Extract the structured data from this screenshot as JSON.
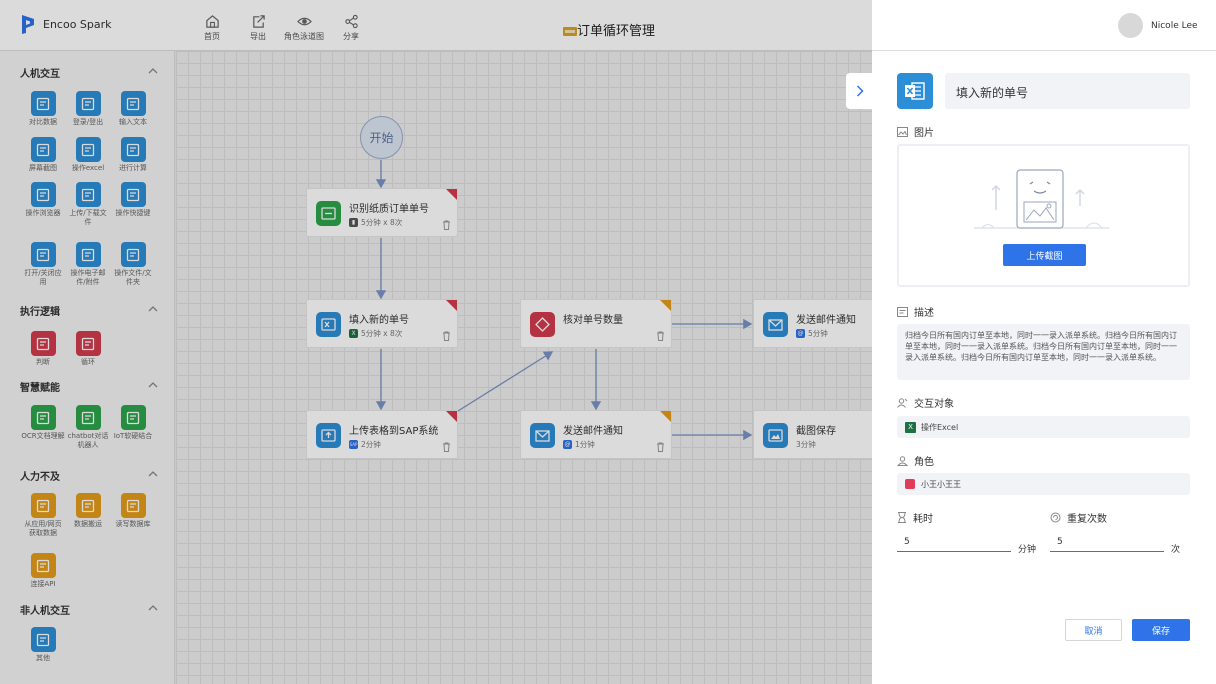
{
  "app": {
    "name": "Encoo Spark"
  },
  "toolbar": {
    "home": "首页",
    "export": "导出",
    "swimlane": "角色泳道图",
    "share": "分享"
  },
  "page": {
    "title": "订单循环管理"
  },
  "user": {
    "name": "Nicole Lee"
  },
  "sidebar": {
    "sections": [
      {
        "title": "人机交互",
        "items": [
          {
            "label": "对比数据",
            "icon": "compare-data-icon"
          },
          {
            "label": "登录/登出",
            "icon": "login-icon"
          },
          {
            "label": "输入文本",
            "icon": "input-text-icon"
          },
          {
            "label": "屏幕截图",
            "icon": "screenshot-icon"
          },
          {
            "label": "操作excel",
            "icon": "excel-icon"
          },
          {
            "label": "进行计算",
            "icon": "calculator-icon"
          },
          {
            "label": "操作浏览器",
            "icon": "browser-icon"
          },
          {
            "label": "上传/下载文件",
            "icon": "upload-download-icon"
          },
          {
            "label": "操作快捷键",
            "icon": "shortcut-icon"
          },
          {
            "label": "打开/关闭应用",
            "icon": "app-icon"
          },
          {
            "label": "操作电子邮件/附件",
            "icon": "email-icon"
          },
          {
            "label": "操作文件/文件夹",
            "icon": "folder-icon"
          }
        ]
      },
      {
        "title": "执行逻辑",
        "items": [
          {
            "label": "判断",
            "icon": "decision-icon"
          },
          {
            "label": "循环",
            "icon": "loop-icon"
          }
        ]
      },
      {
        "title": "智慧赋能",
        "items": [
          {
            "label": "OCR文档理解",
            "icon": "ocr-icon"
          },
          {
            "label": "chatbot对话机器人",
            "icon": "chatbot-icon"
          },
          {
            "label": "IoT软硬结合",
            "icon": "iot-icon"
          }
        ]
      },
      {
        "title": "人力不及",
        "items": [
          {
            "label": "从应用/网页获取数据",
            "icon": "fetch-data-icon"
          },
          {
            "label": "数据搬运",
            "icon": "data-transfer-icon"
          },
          {
            "label": "读写数据库",
            "icon": "database-icon"
          },
          {
            "label": "连接API",
            "icon": "api-icon"
          }
        ]
      },
      {
        "title": "非人机交互",
        "items": [
          {
            "label": "其他",
            "icon": "other-icon"
          }
        ]
      }
    ]
  },
  "flow": {
    "start_label": "开始",
    "nodes": [
      {
        "title": "识别纸质订单单号",
        "meta": "5分钟 x 8次"
      },
      {
        "title": "填入新的单号",
        "meta": "5分钟 x 8次"
      },
      {
        "title": "核对单号数量",
        "meta": ""
      },
      {
        "title": "发送邮件通知",
        "meta": "5分钟"
      },
      {
        "title": "上传表格到SAP系统",
        "meta": "2分钟"
      },
      {
        "title": "发送邮件通知",
        "meta": "1分钟"
      },
      {
        "title": "截图保存",
        "meta": "3分钟"
      }
    ]
  },
  "panel": {
    "node_name": "填入新的单号",
    "image_label": "图片",
    "upload_button": "上传截图",
    "desc_label": "描述",
    "description": "归档今日所有国内订单至本地，同时一一录入派单系统。归档今日所有国内订单至本地，同时一一录入派单系统。归档今日所有国内订单至本地，同时一一录入派单系统。归档今日所有国内订单至本地，同时一一录入派单系统。",
    "target_label": "交互对象",
    "target_value": "操作Excel",
    "role_label": "角色",
    "role_value": "小王小王王",
    "duration_label": "耗时",
    "duration_value": "5",
    "duration_unit": "分钟",
    "repeat_label": "重复次数",
    "repeat_value": "5",
    "repeat_unit": "次",
    "cancel": "取消",
    "save": "保存"
  },
  "colors": {
    "accent": "#2e74e8",
    "tile_blue": "#2c8ed6",
    "tile_red": "#d23b4c",
    "tile_green": "#2ca34b",
    "tile_orange": "#e49b1a",
    "role_color": "#e23b57"
  }
}
